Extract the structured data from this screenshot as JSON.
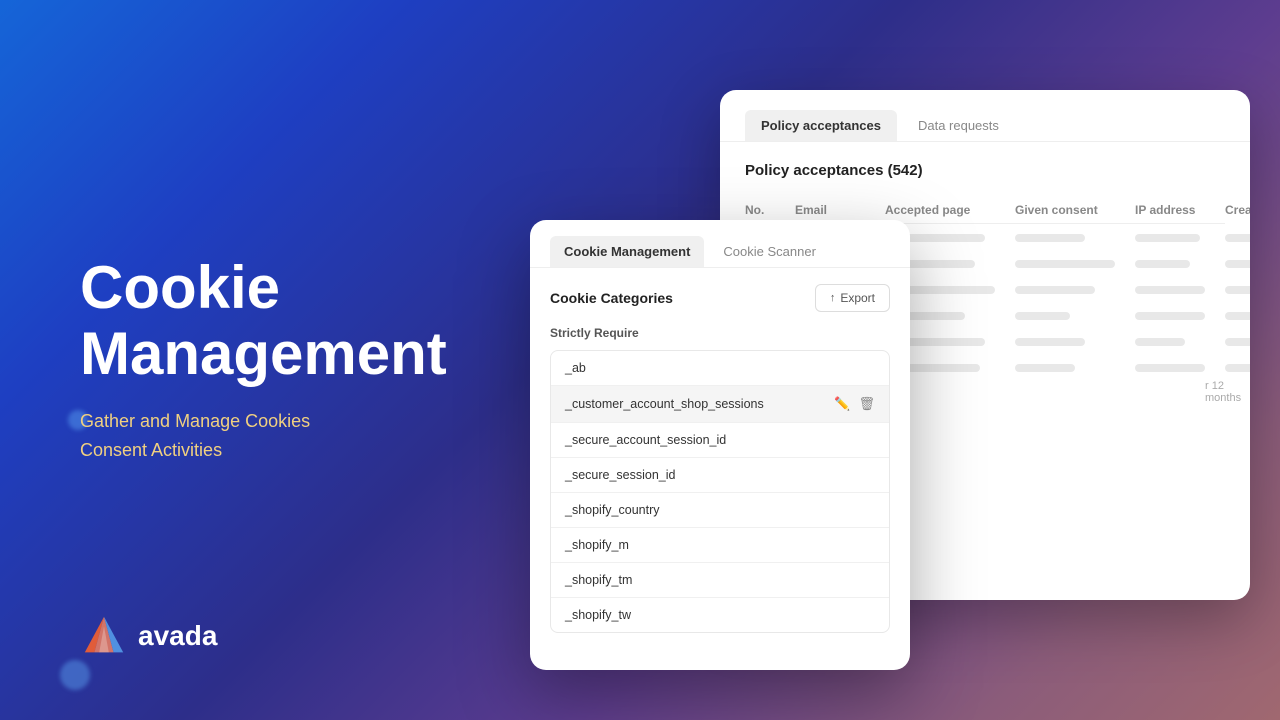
{
  "background": {
    "gradient": "linear-gradient(135deg, #1a6fd4, #2a52c4, #3a3a8c, #6b4a8e, #9b6a7e)"
  },
  "left": {
    "title_line1": "Cookie",
    "title_line2": "Management",
    "subtitle_line1": "Gather and Manage Cookies",
    "subtitle_line2": "Consent Activities"
  },
  "logo": {
    "text": "avada"
  },
  "policy_panel": {
    "tabs": [
      {
        "label": "Policy acceptances",
        "active": true
      },
      {
        "label": "Data requests",
        "active": false
      }
    ],
    "heading": "Policy acceptances (542)",
    "table_headers": [
      "No.",
      "Email",
      "Accepted page",
      "Given consent",
      "IP address",
      "Created at"
    ],
    "last_row_note": "r 12 months"
  },
  "cookie_panel": {
    "tabs": [
      {
        "label": "Cookie Management",
        "active": true
      },
      {
        "label": "Cookie Scanner",
        "active": false
      }
    ],
    "categories_label": "Cookie Categories",
    "export_label": "Export",
    "strictly_require_label": "Strictly Require",
    "cookies": [
      {
        "name": "_ab",
        "highlighted": false
      },
      {
        "name": "_customer_account_shop_sessions",
        "highlighted": true
      },
      {
        "name": "_secure_account_session_id",
        "highlighted": false
      },
      {
        "name": "_secure_session_id",
        "highlighted": false
      },
      {
        "name": "_shopify_country",
        "highlighted": false
      },
      {
        "name": "_shopify_m",
        "highlighted": false
      },
      {
        "name": "_shopify_tm",
        "highlighted": false
      },
      {
        "name": "_shopify_tw",
        "highlighted": false
      }
    ]
  }
}
